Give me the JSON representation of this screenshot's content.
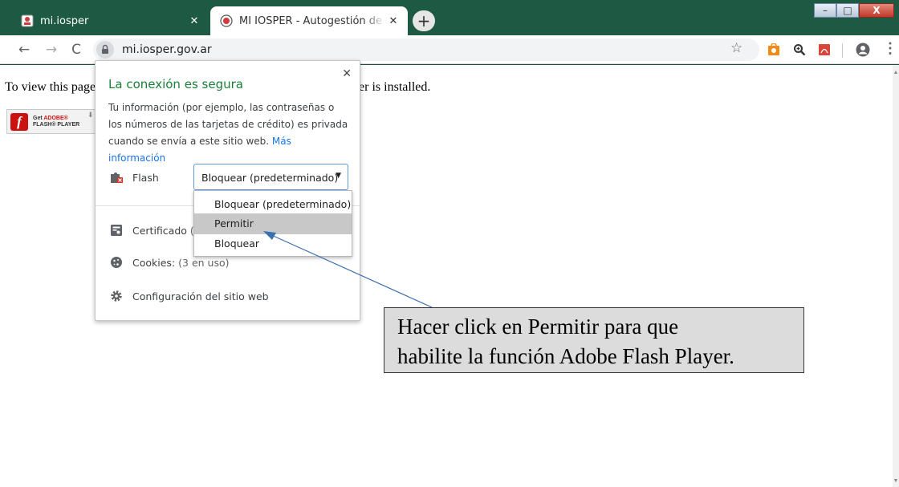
{
  "browser": {
    "tabs": [
      {
        "title": "mi.iosper",
        "active": false
      },
      {
        "title": "MI IOSPER - Autogestión de trám",
        "active": true
      }
    ],
    "close_glyph": "✕",
    "new_tab_glyph": "+",
    "window_buttons": {
      "minimize": "–",
      "maximize": "□",
      "close": "X"
    },
    "nav": {
      "back": "←",
      "forward": "→",
      "reload": "C"
    },
    "url": "mi.iosper.gov.ar",
    "bookmark_glyph": "☆",
    "menu_glyph": "⋮",
    "extensions": [
      "shopping-extension-icon",
      "zoom-extension-icon",
      "pdf-extension-icon",
      "account-icon"
    ]
  },
  "page": {
    "view_message_left": "To view this page",
    "view_message_right": "greater is installed.",
    "flash_badge": {
      "line1_prefix": "Get ",
      "line1_brand": "ADOBE®",
      "line2": "FLASH® PLAYER",
      "logo_glyph": "f"
    }
  },
  "site_info_popup": {
    "close_glyph": "✕",
    "title": "La conexión es segura",
    "description": "Tu información (por ejemplo, las contraseñas o los números de las tarjetas de crédito) es privada cuando se envía a este sitio web.",
    "more_info_link": "Más información",
    "permission": {
      "label": "Flash",
      "selected": "Bloquear (predeterminado)",
      "caret": "▼"
    },
    "rows": [
      {
        "label": "Certificado",
        "detail": "(vá"
      },
      {
        "label": "Cookies:",
        "detail": "(3 en uso)"
      },
      {
        "label": "Configuración del sitio web",
        "detail": ""
      }
    ],
    "dropdown_options": [
      {
        "label": "Bloquear (predeterminado)",
        "highlighted": false
      },
      {
        "label": "Permitir",
        "highlighted": true
      },
      {
        "label": "Bloquear",
        "highlighted": false
      }
    ]
  },
  "annotation": {
    "line1": "Hacer click en Permitir para que",
    "line2": "habilite la función Adobe Flash Player."
  },
  "colors": {
    "title_bar": "#1e5a43",
    "secure_text": "#188038",
    "link": "#1a73e8",
    "highlight": "#c8c8c8",
    "callout_bg": "#dcdcdc",
    "arrow": "#3a6fb0"
  }
}
